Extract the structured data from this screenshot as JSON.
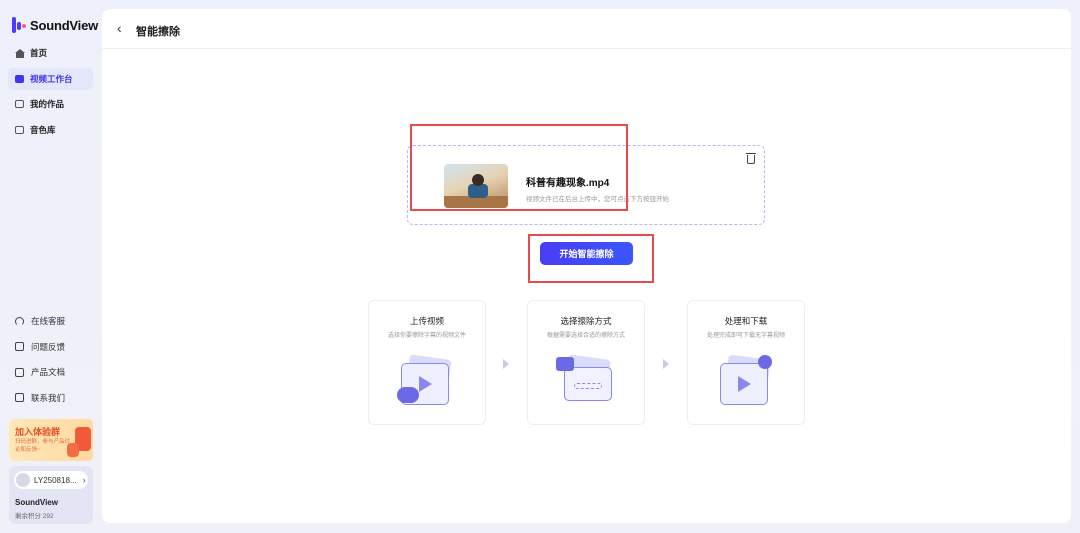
{
  "app": {
    "name": "SoundView"
  },
  "sidebar": {
    "items": [
      {
        "label": "首页",
        "icon": "home-icon",
        "active": false
      },
      {
        "label": "视频工作台",
        "icon": "video-workbench-icon",
        "active": true
      },
      {
        "label": "我的作品",
        "icon": "my-works-icon",
        "active": false
      },
      {
        "label": "音色库",
        "icon": "voice-library-icon",
        "active": false
      }
    ],
    "bottom_items": [
      {
        "label": "在线客服",
        "icon": "headset-icon"
      },
      {
        "label": "问题反馈",
        "icon": "mail-icon"
      },
      {
        "label": "产品文档",
        "icon": "document-icon"
      },
      {
        "label": "联系我们",
        "icon": "qr-code-icon"
      }
    ],
    "promo": {
      "title": "加入体验群",
      "subtitle": "扫码进群，参与产品讨论和反馈~"
    },
    "user": {
      "name": "LY250818...",
      "plan": "SoundView",
      "credits": "剩余积分 292"
    }
  },
  "header": {
    "title": "智能擦除"
  },
  "upload": {
    "file_name": "科普有趣现象.mp4",
    "hint": "视频文件已在后台上传中，您可点击下方按钮开始"
  },
  "start_button": {
    "label": "开始智能擦除"
  },
  "steps": [
    {
      "title": "上传视频",
      "desc": "选择你要擦除字幕的视频文件"
    },
    {
      "title": "选择擦除方式",
      "desc": "根据需要选择合适的擦除方式"
    },
    {
      "title": "处理和下载",
      "desc": "处理完成即可下载无字幕视频"
    }
  ],
  "colors": {
    "accent": "#4a3cf5",
    "highlight": "#e84b4b"
  }
}
